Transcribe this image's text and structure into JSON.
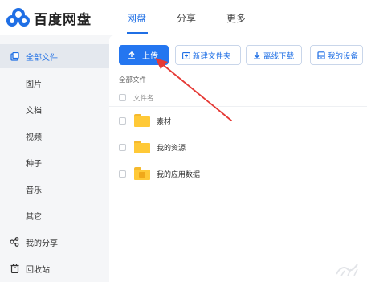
{
  "app": {
    "brand": "百度网盘"
  },
  "nav": {
    "tabs": [
      "网盘",
      "分享",
      "更多"
    ],
    "active": "网盘"
  },
  "sidebar": {
    "items": [
      {
        "label": "全部文件",
        "icon": "all-files-icon",
        "active": true
      },
      {
        "label": "图片"
      },
      {
        "label": "文档"
      },
      {
        "label": "视频"
      },
      {
        "label": "种子"
      },
      {
        "label": "音乐"
      },
      {
        "label": "其它"
      },
      {
        "label": "我的分享",
        "icon": "share-icon"
      },
      {
        "label": "回收站",
        "icon": "trash-icon"
      }
    ]
  },
  "toolbar": {
    "upload_label": "上传",
    "new_folder_label": "新建文件夹",
    "offline_download_label": "离线下载",
    "my_devices_label": "我的设备"
  },
  "breadcrumb": "全部文件",
  "table": {
    "column_filename": "文件名",
    "rows": [
      {
        "name": "素材",
        "type": "folder"
      },
      {
        "name": "我的资源",
        "type": "folder"
      },
      {
        "name": "我的应用数据",
        "type": "app-folder"
      }
    ]
  },
  "colors": {
    "accent": "#1f6fe5",
    "annotation": "#e53935",
    "folder": "#ffc937"
  }
}
